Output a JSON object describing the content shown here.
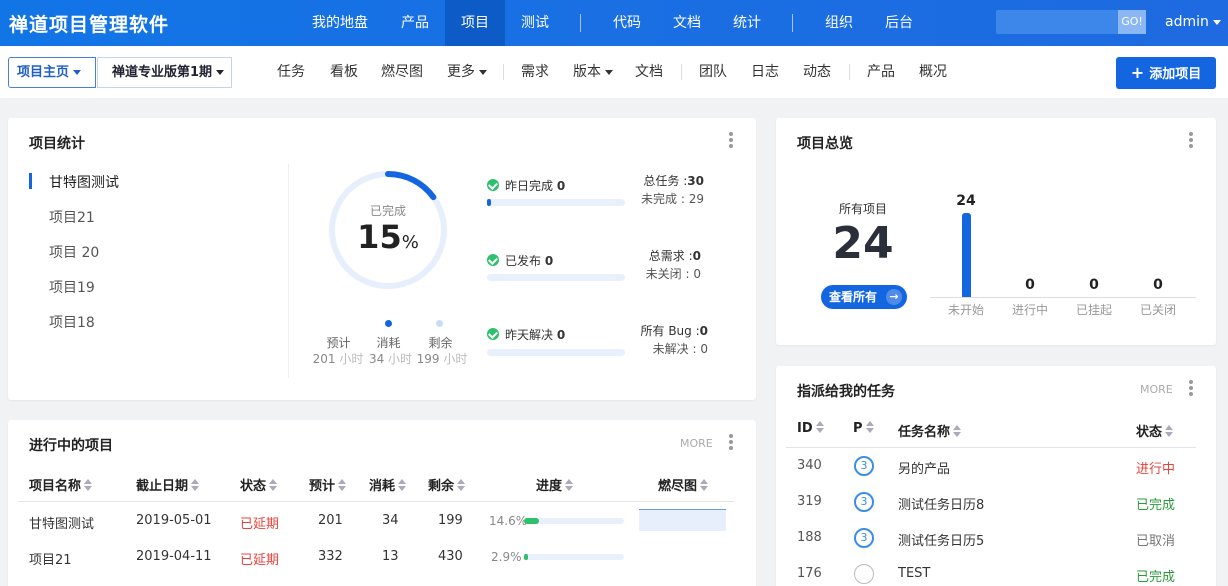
{
  "topbar": {
    "brand": "禅道项目管理软件",
    "nav": [
      "我的地盘",
      "产品",
      "项目",
      "测试",
      "代码",
      "文档",
      "统计",
      "组织",
      "后台"
    ],
    "active": "项目",
    "search_go": "GO!",
    "user": "admin"
  },
  "subbar": {
    "crumb1": "项目主页",
    "crumb2": "禅道专业版第1期",
    "items": [
      "任务",
      "看板",
      "燃尽图",
      "更多",
      "需求",
      "版本",
      "文档",
      "团队",
      "日志",
      "动态",
      "产品",
      "概况"
    ],
    "add_label": "添加项目"
  },
  "stats": {
    "title": "项目统计",
    "projects": [
      "甘特图测试",
      "项目21",
      "项目 20",
      "项目19",
      "项目18"
    ],
    "done_label": "已完成",
    "done_value": "15",
    "done_unit": "%",
    "done_fraction": 0.15,
    "legend": [
      "预计",
      "消耗",
      "剩余"
    ],
    "hours": [
      "201",
      "34",
      "199"
    ],
    "hour_unit": "小时",
    "rows": [
      {
        "label": "昨日完成",
        "value": "0",
        "fill": 0.01,
        "r1_label": "总任务",
        "r1_value": "30",
        "r2_label": "未完成",
        "r2_value": "29"
      },
      {
        "label": "已发布",
        "value": "0",
        "fill": 0,
        "r1_label": "总需求",
        "r1_value": "0",
        "r2_label": "未关闭",
        "r2_value": "0"
      },
      {
        "label": "昨天解决",
        "value": "0",
        "fill": 0,
        "r1_label": "所有 Bug",
        "r1_value": "0",
        "r2_label": "未解决",
        "r2_value": "0"
      }
    ]
  },
  "overview": {
    "title": "项目总览",
    "all_label": "所有项目",
    "all_value": "24",
    "view_all": "查看所有",
    "bars": [
      {
        "label": "未开始",
        "value": "24"
      },
      {
        "label": "进行中",
        "value": "0"
      },
      {
        "label": "已挂起",
        "value": "0"
      },
      {
        "label": "已关闭",
        "value": "0"
      }
    ]
  },
  "ongoing": {
    "title": "进行中的项目",
    "more": "MORE",
    "headers": [
      "项目名称",
      "截止日期",
      "状态",
      "预计",
      "消耗",
      "剩余",
      "进度",
      "燃尽图"
    ],
    "rows": [
      {
        "name": "甘特图测试",
        "date": "2019-05-01",
        "status": "已延期",
        "est": "201",
        "used": "34",
        "left": "199",
        "pct": "14.6%",
        "fill": 0.146
      },
      {
        "name": "项目21",
        "date": "2019-04-11",
        "status": "已延期",
        "est": "332",
        "used": "13",
        "left": "430",
        "pct": "2.9%",
        "fill": 0.029
      }
    ]
  },
  "mytasks": {
    "title": "指派给我的任务",
    "more": "MORE",
    "headers": [
      "ID",
      "P",
      "任务名称",
      "状态"
    ],
    "rows": [
      {
        "id": "340",
        "p": "3",
        "name": "另的产品",
        "status": "进行中",
        "cls": "red"
      },
      {
        "id": "319",
        "p": "3",
        "name": "测试任务日历8",
        "status": "已完成",
        "cls": "green"
      },
      {
        "id": "188",
        "p": "3",
        "name": "测试任务日历5",
        "status": "已取消",
        "cls": "gray"
      },
      {
        "id": "176",
        "p": "",
        "name": "TEST",
        "status": "已完成",
        "cls": "green"
      }
    ]
  }
}
